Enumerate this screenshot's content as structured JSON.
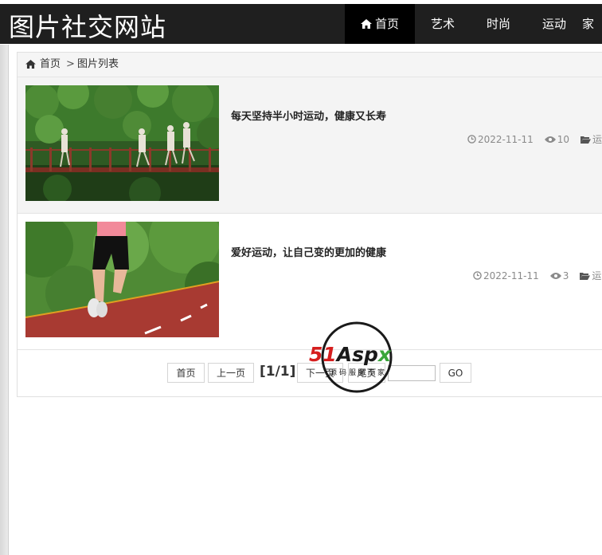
{
  "header": {
    "site_title": "图片社交网站",
    "nav": [
      {
        "label": "首页",
        "active": true
      },
      {
        "label": "艺术",
        "active": false
      },
      {
        "label": "时尚",
        "active": false
      },
      {
        "label": "运动",
        "active": false
      },
      {
        "label": "家",
        "active": false
      }
    ]
  },
  "breadcrumb": {
    "home_label": "首页",
    "separator": ">",
    "current": "图片列表"
  },
  "items": [
    {
      "title": "每天坚持半小时运动，健康又长寿",
      "date": "2022-11-11",
      "views": "10",
      "category": "运动"
    },
    {
      "title": "爱好运动，让自己变的更加的健康",
      "date": "2022-11-11",
      "views": "3",
      "category": "运动"
    }
  ],
  "pager": {
    "first_label": "首页",
    "prev_label": "上一页",
    "page_info": "[1/1]",
    "next_label": "下一页",
    "last_label": "尾页",
    "go_label": "GO"
  },
  "watermark": {
    "brand": "51Aspx",
    "sub": "源码服务专家"
  },
  "colors": {
    "header_bg": "#1f1f1f",
    "nav_active_bg": "#000000",
    "meta_text": "#8a8a8a"
  },
  "icons": [
    "home-icon",
    "clock-icon",
    "eye-icon",
    "folder-icon"
  ]
}
